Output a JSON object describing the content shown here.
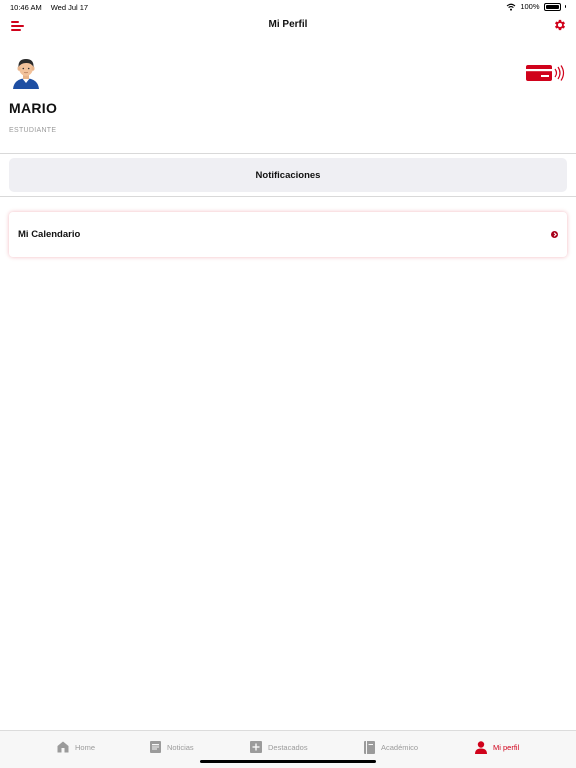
{
  "status_bar": {
    "time": "10:46 AM",
    "date": "Wed Jul 17",
    "battery": "100%",
    "icons": [
      "wifi-icon",
      "battery-icon"
    ]
  },
  "header": {
    "title": "Mi Perfil",
    "menu_icon": "menu-icon",
    "settings_icon": "gear-icon"
  },
  "profile": {
    "avatar_icon": "avatar",
    "card_icon": "nfc-card-icon",
    "name": "MARIO",
    "role": "ESTUDIANTE"
  },
  "notifications": {
    "label": "Notificaciones"
  },
  "calendar": {
    "label": "Mi Calendario",
    "icon": "chevron-right-icon"
  },
  "tabs": [
    {
      "label": "Home",
      "icon": "home-icon",
      "active": false
    },
    {
      "label": "Noticias",
      "icon": "newspaper-icon",
      "active": false
    },
    {
      "label": "Destacados",
      "icon": "plus-box-icon",
      "active": false
    },
    {
      "label": "Académico",
      "icon": "book-icon",
      "active": false
    },
    {
      "label": "Mi perfil",
      "icon": "person-icon",
      "active": true
    }
  ],
  "colors": {
    "accent": "#d0021b",
    "inactive": "#9b9b9b",
    "button_bg": "#efeff3"
  }
}
